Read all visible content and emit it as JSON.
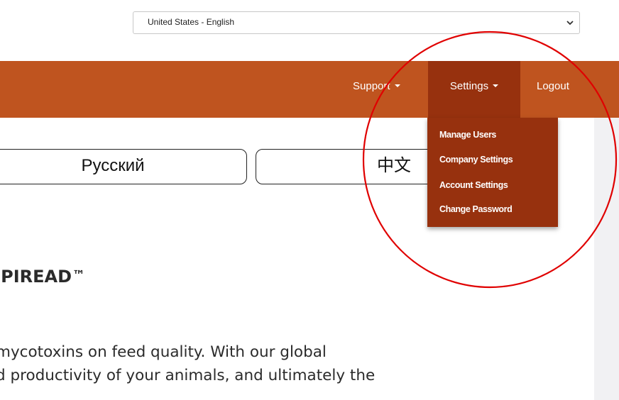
{
  "language_selector": {
    "selected": "United States - English"
  },
  "nav": {
    "support_label": "Support",
    "settings_label": "Settings",
    "logout_label": "Logout"
  },
  "settings_menu": {
    "items": [
      {
        "label": "Manage Users"
      },
      {
        "label": "Company Settings"
      },
      {
        "label": "Account Settings"
      },
      {
        "label": "Change Password"
      }
    ]
  },
  "language_buttons": {
    "russian": "Русский",
    "chinese": "中文"
  },
  "content": {
    "heading": "\tPIREAD",
    "heading_mark": "™",
    "line1": "mycotoxins on feed quality. With our global",
    "line2": "d productivity of your animals, and ultimately the"
  },
  "colors": {
    "navbar": "#bf541f",
    "menu_active": "#97310e",
    "annotation": "#e00000"
  }
}
